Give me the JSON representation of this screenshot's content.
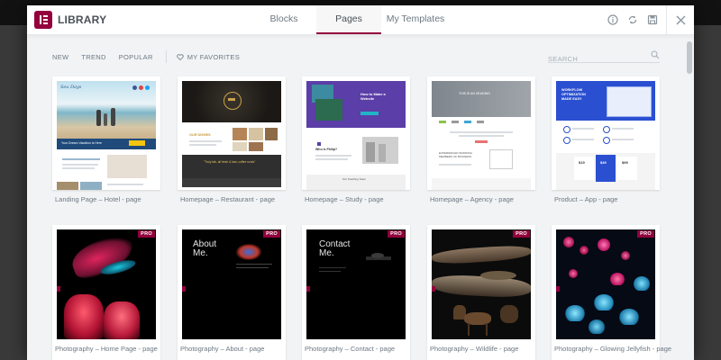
{
  "header": {
    "title": "LIBRARY",
    "tabs": [
      {
        "label": "Blocks",
        "active": false
      },
      {
        "label": "Pages",
        "active": true
      },
      {
        "label": "My Templates",
        "active": false
      }
    ],
    "icons": [
      "info-icon",
      "sync-icon",
      "save-icon",
      "close-icon"
    ]
  },
  "filters": {
    "items": [
      "NEW",
      "TREND",
      "POPULAR"
    ],
    "favorites_label": "MY FAVORITES"
  },
  "search": {
    "placeholder": "SEARCH",
    "value": ""
  },
  "colors": {
    "accent": "#93003c",
    "pro_badge": "#93003c"
  },
  "templates": [
    {
      "label": "Landing Page – Hotel - page",
      "pro": false
    },
    {
      "label": "Homepage – Restaurant - page",
      "pro": false
    },
    {
      "label": "Homepage – Study - page",
      "pro": false
    },
    {
      "label": "Homepage – Agency - page",
      "pro": false
    },
    {
      "label": "Product – App - page",
      "pro": false
    },
    {
      "label": "Photography – Home Page - page",
      "pro": true
    },
    {
      "label": "Photography – About - page",
      "pro": true
    },
    {
      "label": "Photography – Contact - page",
      "pro": true
    },
    {
      "label": "Photography – Wildlife - page",
      "pro": true
    },
    {
      "label": "Photography – Glowing Jellyfish - page",
      "pro": true
    }
  ],
  "pro_badge_label": "PRO",
  "thumb_text": {
    "hotel_caption": "Your Dream Vacation is Here",
    "hotel_script": "Sea Days",
    "restaurant_heading": "OUR DISHES",
    "restaurant_quote": "\"Truly fab, all fresh & fast, coffee rocks\"",
    "study_heading": "How to Make a Website",
    "study_who": "Who is Philip?",
    "study_team": "Our Teaching Team",
    "agency_heading": "THIS IS AN HEADING",
    "agency_sub": "EXPERIENCED WORKING MEMBERS OF BUSINESS",
    "app_heading": "WORKFLOW OPTIMIZATION MADE EASY",
    "app_prices": [
      "$19",
      "$49",
      "$99"
    ],
    "about_heading": "About Me.",
    "contact_heading": "Contact Me."
  }
}
